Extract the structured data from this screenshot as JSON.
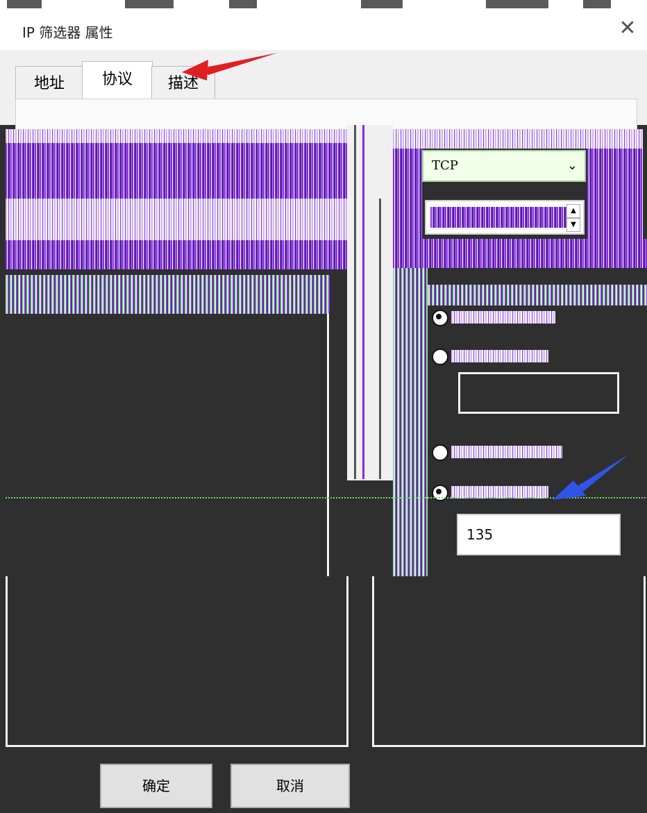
{
  "window": {
    "title": "IP 筛选器 属性",
    "close_icon": "close-icon"
  },
  "tabs": [
    {
      "label": "地址",
      "active": false
    },
    {
      "label": "协议",
      "active": true
    },
    {
      "label": "描述",
      "active": false
    }
  ],
  "protocol": {
    "selected": "TCP",
    "chevron_icon": "chevron-down-icon"
  },
  "ports": {
    "destination_port_value": "135"
  },
  "buttons": {
    "ok": "确定",
    "cancel": "取消"
  },
  "annotations": {
    "arrow_red_color": "#e02020",
    "arrow_blue_color": "#2f55e8"
  }
}
